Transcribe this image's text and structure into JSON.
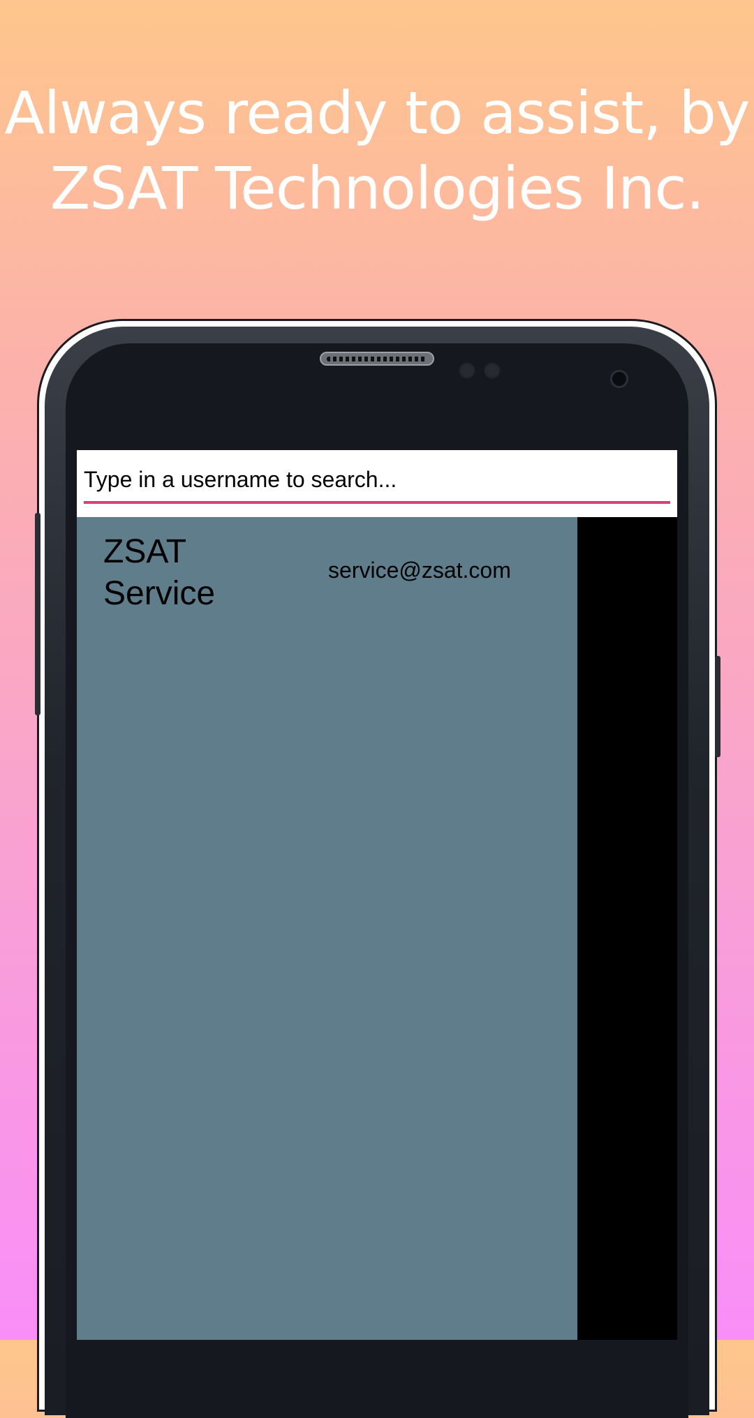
{
  "promo": {
    "headline_line1": "Always ready to assist, by",
    "headline_line2": "ZSAT Technologies Inc."
  },
  "search": {
    "placeholder": "Type in a username to search...",
    "value": "",
    "underline_color": "#d8427b"
  },
  "users": [
    {
      "name": "ZSAT Service",
      "email": "service@zsat.com"
    }
  ],
  "colors": {
    "gradient_top": "#fec68c",
    "gradient_bottom": "#f98ef8",
    "list_background": "#607d8b"
  }
}
